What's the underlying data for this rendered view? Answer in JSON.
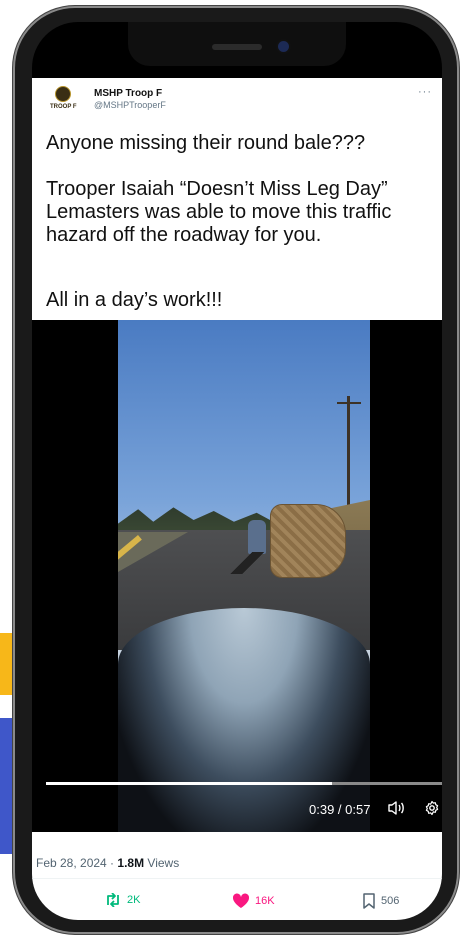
{
  "tweet": {
    "author_name": "MSHP Troop F",
    "author_handle": "@MSHPTrooperF",
    "avatar_label": "TROOP F",
    "more_label": "···",
    "text_line1": "Anyone missing their round bale???",
    "text_para2": "Trooper Isaiah “Doesn’t Miss Leg Day” Lemasters was able to move this traffic hazard off the roadway for you.",
    "text_line3": "All in a day’s work!!!",
    "date": "Feb 28, 2024 · ",
    "views_count": "1.8M",
    "views_label": " Views"
  },
  "video": {
    "time_label": "0:39 / 0:57",
    "progress": 0.684
  },
  "actions": {
    "retweets": "2K",
    "likes": "16K",
    "bookmarks": "506"
  },
  "colors": {
    "retweet": "#00ba7c",
    "like": "#f91880",
    "accent_yellow": "#f7b719",
    "accent_blue": "#3f57c9"
  },
  "icons": [
    "retweet-icon",
    "heart-icon",
    "bookmark-icon",
    "volume-icon",
    "settings-icon",
    "more-icon"
  ]
}
